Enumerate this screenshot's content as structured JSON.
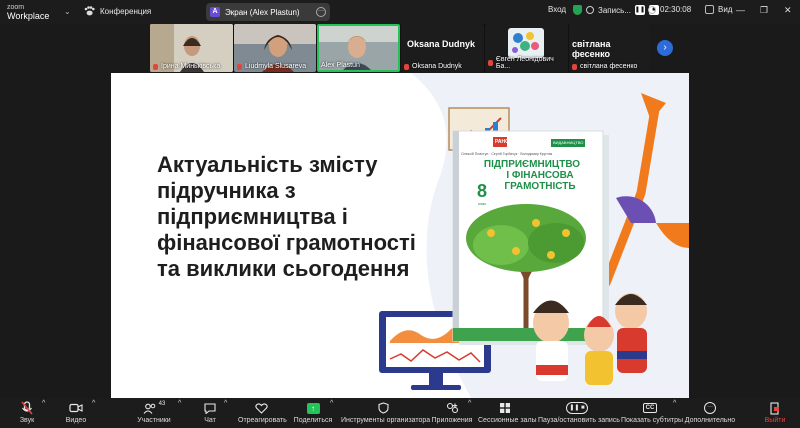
{
  "app": {
    "brand_top": "zoom",
    "brand_bottom": "Workplace"
  },
  "header": {
    "conference_label": "Конференция",
    "screen_share": {
      "badge": "A",
      "label": "Экран (Alex Plastun)"
    },
    "enter_label": "Вход",
    "record_label": "Запись...",
    "timer": "02:30:08",
    "view_label": "Вид"
  },
  "participants": [
    {
      "name": "Ірина Миньківська",
      "muted": true
    },
    {
      "name": "Liudmyla Slusareva",
      "muted": true
    },
    {
      "name": "Alex Plastun",
      "muted": false,
      "active": true
    },
    {
      "name": "Oksana Dudnyk",
      "display": "Oksana Dudnyk",
      "muted": true
    },
    {
      "name": "Євген Леонідович Ба...",
      "muted": true
    },
    {
      "name": "світлана фесенко",
      "display": "світлана фесенко",
      "muted": true
    }
  ],
  "slide": {
    "title_lines": [
      "Актуальність змісту",
      "підручника з",
      "підприємництва і",
      "фінансової грамотності",
      "та виклики сьогодення"
    ],
    "book": {
      "publisher": "РАНОК",
      "series": "ВИДАВНИЦТВО",
      "authors": "Олексій Пластун · Сергій Горбачук · Володимир Кругляк",
      "title_line1": "ПІДПРИЄМНИЦТВО",
      "title_line2": "І ФІНАНСОВА",
      "title_line3": "ГРАМОТНІСТЬ",
      "grade": "8",
      "grade_label": "клас"
    }
  },
  "toolbar": {
    "audio": "Звук",
    "video": "Видео",
    "participants": "Участники",
    "participants_count": "43",
    "chat": "Чат",
    "react": "Отреагировать",
    "share": "Поделиться",
    "host_tools": "Инструменты организатора",
    "apps": "Приложения",
    "breakout": "Сессионные залы",
    "pause_recording": "Пауза/остановить запись",
    "captions": "Показать субтитры",
    "more": "Дополнительно",
    "leave": "Выйти"
  },
  "colors": {
    "accent": "#2d6bd9",
    "active_tile": "#23c35a",
    "record_red": "#e2453c",
    "shield_green": "#23a455",
    "book_green": "#1f8f4a",
    "arrow_orange": "#f07a1c"
  }
}
